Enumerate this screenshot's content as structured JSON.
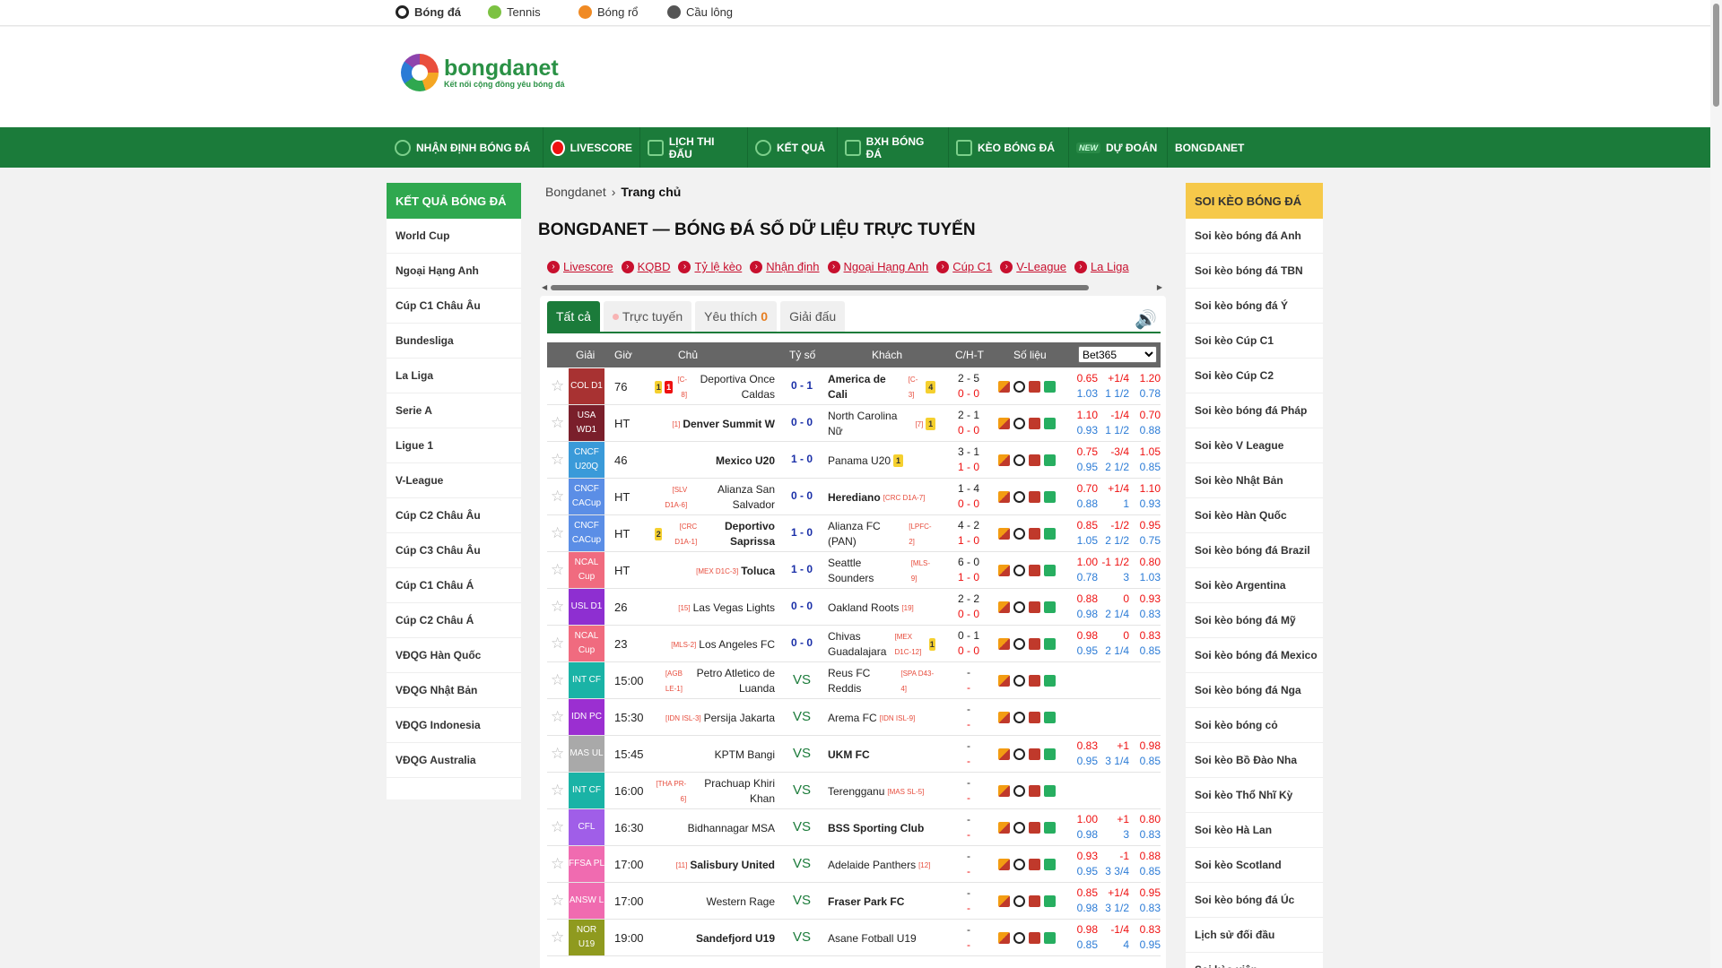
{
  "topbar": {
    "sports": [
      {
        "label": "Bóng đá",
        "color": "#222"
      },
      {
        "label": "Tennis",
        "color": "#7cc242"
      },
      {
        "label": "Bóng rổ",
        "color": "#f08a24"
      },
      {
        "label": "Cầu lông",
        "color": "#555"
      }
    ]
  },
  "logo": {
    "name": "bongdanet",
    "tagline": "Kết nối cộng đồng yêu bóng đá"
  },
  "nav": {
    "items": [
      "NHẬN ĐỊNH BÓNG ĐÁ",
      "LIVESCORE",
      "LỊCH THI ĐẤU",
      "KẾT QUẢ",
      "BXH BÓNG ĐÁ",
      "KÈO BÓNG ĐÁ",
      "DỰ ĐOÁN",
      "BONGDANET"
    ],
    "new_badge": "NEW"
  },
  "left_sidebar": {
    "title": "KẾT QUẢ BÓNG ĐÁ",
    "items": [
      "World Cup",
      "Ngoại Hạng Anh",
      "Cúp C1 Châu Âu",
      "Bundesliga",
      "La Liga",
      "Serie A",
      "Ligue 1",
      "V-League",
      "Cúp C2 Châu Âu",
      "Cúp C3 Châu Âu",
      "Cúp C1 Châu Á",
      "Cúp C2 Châu Á",
      "VĐQG Hàn Quốc",
      "VĐQG Nhật Bản",
      "VĐQG Indonesia",
      "VĐQG Australia"
    ]
  },
  "right_sidebar": {
    "title": "SOI KÈO BÓNG ĐÁ",
    "items": [
      "Soi kèo bóng đá Anh",
      "Soi kèo bóng đá TBN",
      "Soi kèo bóng đá Ý",
      "Soi kèo Cúp C1",
      "Soi kèo Cúp C2",
      "Soi kèo bóng đá Pháp",
      "Soi kèo V League",
      "Soi kèo Nhật Bản",
      "Soi kèo Hàn Quốc",
      "Soi kèo bóng đá Brazil",
      "Soi kèo Argentina",
      "Soi kèo bóng đá Mỹ",
      "Soi kèo bóng đá Mexico",
      "Soi kèo bóng đá Nga",
      "Soi kèo bóng cỏ",
      "Soi kèo Bồ Đào Nha",
      "Soi kèo Thổ Nhĩ Kỳ",
      "Soi kèo Hà Lan",
      "Soi kèo Scotland",
      "Soi kèo bóng đá Úc",
      "Lịch sử đối đầu",
      "Soi kèo xiên"
    ]
  },
  "breadcrumb": {
    "root": "Bongdanet",
    "current": "Trang chủ"
  },
  "page_title": "BONGDANET — BÓNG ĐÁ SỐ DỮ LIỆU TRỰC TUYẾN",
  "quick_links": [
    "Livescore",
    "KQBD",
    "Tỷ lệ kèo",
    "Nhận định",
    "Ngoại Hạng Anh",
    "Cúp C1",
    "V-League",
    "La Liga"
  ],
  "tabs": {
    "all": "Tất cả",
    "live": "Trực tuyến",
    "fav": "Yêu thích",
    "fav_count": "0",
    "league": "Giải đấu"
  },
  "table_header": {
    "league": "Giải",
    "time": "Giờ",
    "home": "Chủ",
    "score": "Tỷ số",
    "away": "Khách",
    "ch_t": "C/H-T",
    "stats": "Số liệu",
    "bookmaker": "Bet365"
  },
  "vs_label": "VS",
  "matches": [
    {
      "league": "COL D1",
      "color": "#a83232",
      "time": "76",
      "home": "Deportiva Once Caldas",
      "home_rank": "[C-8]",
      "home_cards": [
        {
          "t": "y",
          "n": "1"
        },
        {
          "t": "r",
          "n": "1"
        }
      ],
      "home_bold": false,
      "score": "0 - 1",
      "away": "America de Cali",
      "away_rank": "[C-3]",
      "away_cards": [
        {
          "t": "y",
          "n": "4"
        }
      ],
      "away_bold": true,
      "corners": "2 - 5",
      "ht": "0 - 0",
      "odds1": [
        "0.65",
        "+1/4",
        "1.20"
      ],
      "odds2": [
        "1.03",
        "1 1/2",
        "0.78"
      ]
    },
    {
      "league": "USA WD1",
      "color": "#7a1f2b",
      "time": "HT",
      "home": "Denver Summit W",
      "home_rank": "[1]",
      "home_cards": [],
      "home_bold": true,
      "score": "0 - 0",
      "away": "North Carolina Nữ",
      "away_rank": "[7]",
      "away_cards": [
        {
          "t": "y",
          "n": "1"
        }
      ],
      "away_bold": false,
      "corners": "2 - 1",
      "ht": "0 - 0",
      "odds1": [
        "1.10",
        "-1/4",
        "0.70"
      ],
      "odds2": [
        "0.93",
        "1 1/2",
        "0.88"
      ]
    },
    {
      "league": "CNCF U20Q",
      "color": "#3a9ad9",
      "time": "46",
      "home": "Mexico U20",
      "home_rank": "",
      "home_cards": [],
      "home_bold": true,
      "score": "1 - 0",
      "away": "Panama U20",
      "away_rank": "",
      "away_cards": [
        {
          "t": "y",
          "n": "1"
        }
      ],
      "away_bold": false,
      "corners": "3 - 1",
      "ht": "1 - 0",
      "odds1": [
        "0.75",
        "-3/4",
        "1.05"
      ],
      "odds2": [
        "0.95",
        "2 1/2",
        "0.85"
      ]
    },
    {
      "league": "CNCF CACup",
      "color": "#5b8ee6",
      "time": "HT",
      "home": "Alianza San Salvador",
      "home_rank": "[SLV D1A-6]",
      "home_cards": [],
      "home_bold": false,
      "score": "0 - 0",
      "away": "Herediano",
      "away_rank": "[CRC D1A-7]",
      "away_cards": [],
      "away_bold": true,
      "corners": "1 - 4",
      "ht": "0 - 0",
      "odds1": [
        "0.70",
        "+1/4",
        "1.10"
      ],
      "odds2": [
        "0.88",
        "1",
        "0.93"
      ]
    },
    {
      "league": "CNCF CACup",
      "color": "#5b8ee6",
      "time": "HT",
      "home": "Deportivo Saprissa",
      "home_rank": "[CRC D1A-1]",
      "home_cards": [
        {
          "t": "y",
          "n": "2"
        }
      ],
      "home_bold": true,
      "score": "1 - 0",
      "away": "Alianza FC (PAN)",
      "away_rank": "[LPFC-2]",
      "away_cards": [],
      "away_bold": false,
      "corners": "4 - 2",
      "ht": "1 - 0",
      "odds1": [
        "0.85",
        "-1/2",
        "0.95"
      ],
      "odds2": [
        "1.05",
        "2 1/2",
        "0.75"
      ]
    },
    {
      "league": "NCAL Cup",
      "color": "#f06b7f",
      "time": "HT",
      "home": "Toluca",
      "home_rank": "[MEX D1C-3]",
      "home_cards": [],
      "home_bold": true,
      "score": "1 - 0",
      "away": "Seattle Sounders",
      "away_rank": "[MLS-9]",
      "away_cards": [],
      "away_bold": false,
      "corners": "6 - 0",
      "ht": "1 - 0",
      "odds1": [
        "1.00",
        "-1 1/2",
        "0.80"
      ],
      "odds2": [
        "0.78",
        "3",
        "1.03"
      ]
    },
    {
      "league": "USL D1",
      "color": "#8e2fd1",
      "time": "26",
      "home": "Las Vegas Lights",
      "home_rank": "[15]",
      "home_cards": [],
      "home_bold": false,
      "score": "0 - 0",
      "away": "Oakland Roots",
      "away_rank": "[19]",
      "away_cards": [],
      "away_bold": false,
      "corners": "2 - 2",
      "ht": "0 - 0",
      "odds1": [
        "0.88",
        "0",
        "0.93"
      ],
      "odds2": [
        "0.98",
        "2 1/4",
        "0.83"
      ]
    },
    {
      "league": "NCAL Cup",
      "color": "#f06b7f",
      "time": "23",
      "home": "Los Angeles FC",
      "home_rank": "[MLS-2]",
      "home_cards": [],
      "home_bold": false,
      "score": "0 - 0",
      "away": "Chivas Guadalajara",
      "away_rank": "[MEX D1C-12]",
      "away_cards": [
        {
          "t": "y",
          "n": "1"
        }
      ],
      "away_bold": false,
      "corners": "0 - 1",
      "ht": "0 - 0",
      "odds1": [
        "0.98",
        "0",
        "0.83"
      ],
      "odds2": [
        "0.95",
        "2 1/4",
        "0.85"
      ]
    },
    {
      "league": "INT CF",
      "color": "#1ab3a6",
      "time": "15:00",
      "home": "Petro Atletico de Luanda",
      "home_rank": "[AGB LE-1]",
      "home_cards": [],
      "home_bold": false,
      "score": "",
      "away": "Reus FC Reddis",
      "away_rank": "[SPA D43-4]",
      "away_cards": [],
      "away_bold": false,
      "corners": "-",
      "ht": "-",
      "odds1": [],
      "odds2": []
    },
    {
      "league": "IDN PC",
      "color": "#9b2fd1",
      "time": "15:30",
      "home": "Persija Jakarta",
      "home_rank": "[IDN ISL-3]",
      "home_cards": [],
      "home_bold": false,
      "score": "",
      "away": "Arema FC",
      "away_rank": "[IDN ISL-9]",
      "away_cards": [],
      "away_bold": false,
      "corners": "-",
      "ht": "-",
      "odds1": [],
      "odds2": []
    },
    {
      "league": "MAS UL",
      "color": "#a9a9a9",
      "time": "15:45",
      "home": "KPTM Bangi",
      "home_rank": "",
      "home_cards": [],
      "home_bold": false,
      "score": "",
      "away": "UKM FC",
      "away_rank": "",
      "away_cards": [],
      "away_bold": true,
      "corners": "-",
      "ht": "-",
      "odds1": [
        "0.83",
        "+1",
        "0.98"
      ],
      "odds2": [
        "0.95",
        "3 1/4",
        "0.85"
      ]
    },
    {
      "league": "INT CF",
      "color": "#1ab3a6",
      "time": "16:00",
      "home": "Prachuap Khiri Khan",
      "home_rank": "[THA PR-6]",
      "home_cards": [],
      "home_bold": false,
      "score": "",
      "away": "Terengganu",
      "away_rank": "[MAS SL-5]",
      "away_cards": [],
      "away_bold": false,
      "corners": "-",
      "ht": "-",
      "odds1": [],
      "odds2": []
    },
    {
      "league": "CFL",
      "color": "#a05ee8",
      "time": "16:30",
      "home": "Bidhannagar MSA",
      "home_rank": "",
      "home_cards": [],
      "home_bold": false,
      "score": "",
      "away": "BSS Sporting Club",
      "away_rank": "",
      "away_cards": [],
      "away_bold": true,
      "corners": "-",
      "ht": "-",
      "odds1": [
        "1.00",
        "+1",
        "0.80"
      ],
      "odds2": [
        "0.98",
        "3",
        "0.83"
      ]
    },
    {
      "league": "FFSA PL",
      "color": "#f06bb0",
      "time": "17:00",
      "home": "Salisbury United",
      "home_rank": "[11]",
      "home_cards": [],
      "home_bold": true,
      "score": "",
      "away": "Adelaide Panthers",
      "away_rank": "[12]",
      "away_cards": [],
      "away_bold": false,
      "corners": "-",
      "ht": "-",
      "odds1": [
        "0.93",
        "-1",
        "0.88"
      ],
      "odds2": [
        "0.95",
        "3 3/4",
        "0.85"
      ]
    },
    {
      "league": "ANSW L",
      "color": "#f06bb0",
      "time": "17:00",
      "home": "Western Rage",
      "home_rank": "",
      "home_cards": [],
      "home_bold": false,
      "score": "",
      "away": "Fraser Park FC",
      "away_rank": "",
      "away_cards": [],
      "away_bold": true,
      "corners": "-",
      "ht": "-",
      "odds1": [
        "0.85",
        "+1/4",
        "0.95"
      ],
      "odds2": [
        "0.98",
        "3 1/2",
        "0.83"
      ]
    },
    {
      "league": "NOR U19",
      "color": "#8f9a1f",
      "time": "19:00",
      "home": "Sandefjord U19",
      "home_rank": "",
      "home_cards": [],
      "home_bold": true,
      "score": "",
      "away": "Asane Fotball U19",
      "away_rank": "",
      "away_cards": [],
      "away_bold": false,
      "corners": "-",
      "ht": "-",
      "odds1": [
        "0.98",
        "-1/4",
        "0.83"
      ],
      "odds2": [
        "0.85",
        "4",
        "0.95"
      ]
    }
  ]
}
